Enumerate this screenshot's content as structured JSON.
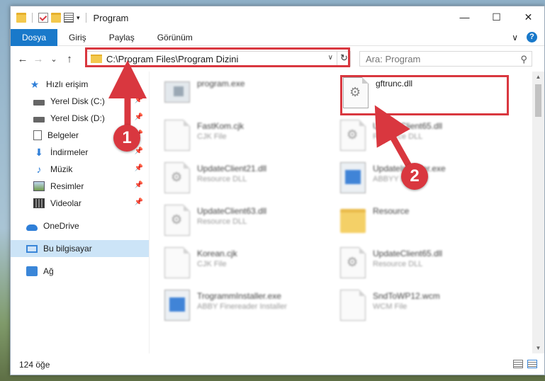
{
  "window": {
    "title": "Program",
    "controls": {
      "minimize": "—",
      "maximize": "☐",
      "close": "✕"
    }
  },
  "ribbon": {
    "tabs": [
      "Dosya",
      "Giriş",
      "Paylaş",
      "Görünüm"
    ],
    "active_tab": "Dosya",
    "expand_icon": "∨",
    "help_icon": "?"
  },
  "nav": {
    "back": "←",
    "forward": "→",
    "recent": "⌄",
    "up": "↑",
    "address": "C:\\Program Files\\Program Dizini",
    "address_arrow": "∨",
    "refresh": "↻",
    "search_placeholder": "Ara: Program",
    "search_icon": "⚲"
  },
  "sidebar": {
    "items": [
      {
        "label": "Hızlı erişim",
        "icon": "star-icon",
        "pinned": false
      },
      {
        "label": "Yerel Disk (C:)",
        "icon": "drive-icon",
        "pinned": true
      },
      {
        "label": "Yerel Disk (D:)",
        "icon": "drive-icon",
        "pinned": true
      },
      {
        "label": "Belgeler",
        "icon": "documents-icon",
        "pinned": true
      },
      {
        "label": "İndirmeler",
        "icon": "download-icon",
        "pinned": true
      },
      {
        "label": "Müzik",
        "icon": "music-icon",
        "pinned": true
      },
      {
        "label": "Resimler",
        "icon": "pictures-icon",
        "pinned": true
      },
      {
        "label": "Videolar",
        "icon": "videos-icon",
        "pinned": true
      },
      {
        "label": "OneDrive",
        "icon": "onedrive-icon",
        "pinned": false
      },
      {
        "label": "Bu bilgisayar",
        "icon": "this-pc-icon",
        "pinned": false,
        "selected": true
      },
      {
        "label": "Ağ",
        "icon": "network-icon",
        "pinned": false
      }
    ],
    "pin_icon": "📌"
  },
  "files": [
    {
      "name": "program.exe",
      "type": "",
      "icon": "exe"
    },
    {
      "name": "gftrunc.dll",
      "type": "",
      "icon": "gear"
    },
    {
      "name": "FastKom.cjk",
      "type": "CJK File",
      "icon": "doc"
    },
    {
      "name": "UpdateClient65.dll",
      "type": "Resource DLL",
      "icon": "gear"
    },
    {
      "name": "UpdateClient21.dll",
      "type": "Resource DLL",
      "icon": "gear"
    },
    {
      "name": "UpdateInstaller.exe",
      "type": "ABBYY Installer",
      "icon": "app"
    },
    {
      "name": "UpdateClient63.dll",
      "type": "Resource DLL",
      "icon": "gear"
    },
    {
      "name": "Resource",
      "type": "",
      "icon": "folder"
    },
    {
      "name": "Korean.cjk",
      "type": "CJK File",
      "icon": "doc"
    },
    {
      "name": "UpdateClient65.dll",
      "type": "Resource DLL",
      "icon": "gear"
    },
    {
      "name": "TrogrammInstaller.exe",
      "type": "ABBY Finereader Installer",
      "icon": "app"
    },
    {
      "name": "SndToWP12.wcm",
      "type": "WCM File",
      "icon": "doc"
    }
  ],
  "status": {
    "count": "124 öğe"
  },
  "markers": [
    "1",
    "2"
  ],
  "colors": {
    "accent": "#1979ca",
    "highlight": "#d9373f",
    "selection": "#cce4f7"
  }
}
